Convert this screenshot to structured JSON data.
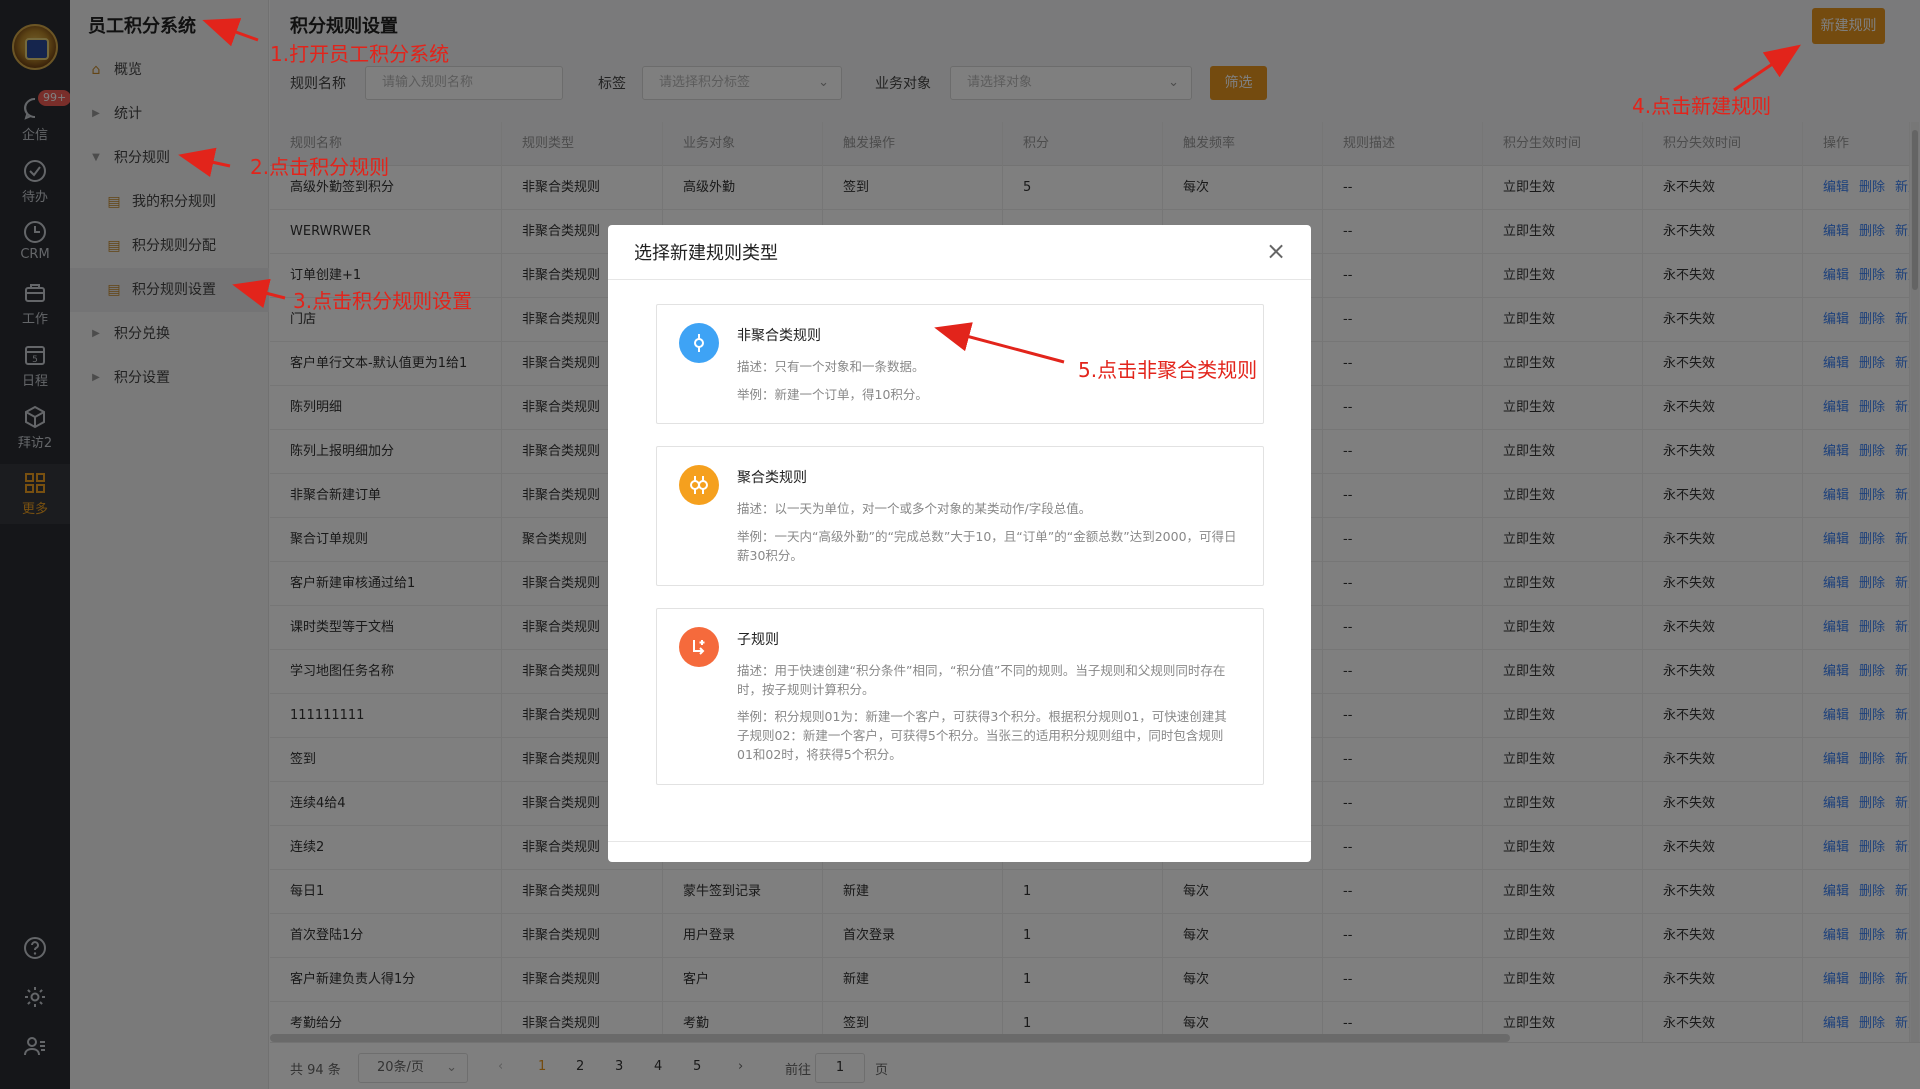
{
  "rail": {
    "items": [
      {
        "label": "企信",
        "icon": "chat-icon",
        "badge": "99+"
      },
      {
        "label": "待办",
        "icon": "check-circle-icon"
      },
      {
        "label": "CRM",
        "icon": "clock-icon"
      },
      {
        "label": "工作",
        "icon": "briefcase-icon"
      },
      {
        "label": "日程",
        "icon": "calendar-icon",
        "day": "5"
      },
      {
        "label": "拜访2",
        "icon": "cube-icon"
      },
      {
        "label": "更多",
        "icon": "grid-icon"
      }
    ],
    "bottom_icons": [
      "help-icon",
      "settings-icon",
      "user-list-icon"
    ]
  },
  "sidebar": {
    "title": "员工积分系统",
    "items": [
      {
        "label": "概览",
        "icon": "home-icon"
      },
      {
        "label": "统计",
        "icon": "caret-right-icon"
      },
      {
        "label": "积分规则",
        "icon": "caret-down-icon"
      },
      {
        "label": "我的积分规则",
        "icon": "doc-icon"
      },
      {
        "label": "积分规则分配",
        "icon": "doc-icon"
      },
      {
        "label": "积分规则设置",
        "icon": "doc-icon"
      },
      {
        "label": "积分兑换",
        "icon": "caret-right-icon"
      },
      {
        "label": "积分设置",
        "icon": "caret-right-icon"
      }
    ]
  },
  "page": {
    "title": "积分规则设置",
    "new_button": "新建规则",
    "filters": {
      "name_label": "规则名称",
      "name_placeholder": "请输入规则名称",
      "tag_label": "标签",
      "tag_placeholder": "请选择积分标签",
      "object_label": "业务对象",
      "object_placeholder": "请选择对象",
      "filter_button": "筛选"
    }
  },
  "table": {
    "columns": [
      "规则名称",
      "规则类型",
      "业务对象",
      "触发操作",
      "积分",
      "触发频率",
      "规则描述",
      "积分生效时间",
      "积分失效时间",
      "操作"
    ],
    "ops": [
      "编辑",
      "删除",
      "新建子规则"
    ],
    "rows": [
      [
        "高级外勤签到积分",
        "非聚合类规则",
        "高级外勤",
        "签到",
        "5",
        "每次",
        "--",
        "立即生效",
        "永不失效"
      ],
      [
        "WERWRWER",
        "非聚合类规则",
        "",
        "",
        "",
        "",
        "--",
        "立即生效",
        "永不失效"
      ],
      [
        "订单创建+1",
        "非聚合类规则",
        "",
        "",
        "",
        "",
        "--",
        "立即生效",
        "永不失效"
      ],
      [
        "门店",
        "非聚合类规则",
        "",
        "",
        "",
        "",
        "--",
        "立即生效",
        "永不失效"
      ],
      [
        "客户单行文本-默认值更为1给1",
        "非聚合类规则",
        "",
        "",
        "",
        "",
        "--",
        "立即生效",
        "永不失效"
      ],
      [
        "陈列明细",
        "非聚合类规则",
        "",
        "",
        "",
        "",
        "--",
        "立即生效",
        "永不失效"
      ],
      [
        "陈列上报明细加分",
        "非聚合类规则",
        "",
        "",
        "",
        "",
        "--",
        "立即生效",
        "永不失效"
      ],
      [
        "非聚合新建订单",
        "非聚合类规则",
        "",
        "",
        "",
        "",
        "--",
        "立即生效",
        "永不失效"
      ],
      [
        "聚合订单规则",
        "聚合类规则",
        "",
        "",
        "",
        "",
        "--",
        "立即生效",
        "永不失效"
      ],
      [
        "客户新建审核通过给1",
        "非聚合类规则",
        "",
        "",
        "",
        "",
        "--",
        "立即生效",
        "永不失效"
      ],
      [
        "课时类型等于文档",
        "非聚合类规则",
        "",
        "",
        "",
        "",
        "--",
        "立即生效",
        "永不失效"
      ],
      [
        "学习地图任务名称",
        "非聚合类规则",
        "",
        "",
        "",
        "",
        "--",
        "立即生效",
        "永不失效"
      ],
      [
        "111111111",
        "非聚合类规则",
        "",
        "",
        "",
        "",
        "--",
        "立即生效",
        "永不失效"
      ],
      [
        "签到",
        "非聚合类规则",
        "",
        "",
        "",
        "",
        "--",
        "立即生效",
        "永不失效"
      ],
      [
        "连续4给4",
        "非聚合类规则",
        "",
        "",
        "",
        "",
        "--",
        "立即生效",
        "永不失效"
      ],
      [
        "连续2",
        "非聚合类规则",
        "",
        "",
        "",
        "",
        "--",
        "立即生效",
        "永不失效"
      ],
      [
        "每日1",
        "非聚合类规则",
        "蒙牛签到记录",
        "新建",
        "1",
        "每次",
        "--",
        "立即生效",
        "永不失效"
      ],
      [
        "首次登陆1分",
        "非聚合类规则",
        "用户登录",
        "首次登录",
        "1",
        "每次",
        "--",
        "立即生效",
        "永不失效"
      ],
      [
        "客户新建负责人得1分",
        "非聚合类规则",
        "客户",
        "新建",
        "1",
        "每次",
        "--",
        "立即生效",
        "永不失效"
      ],
      [
        "考勤给分",
        "非聚合类规则",
        "考勤",
        "签到",
        "1",
        "每次",
        "--",
        "立即生效",
        "永不失效"
      ]
    ]
  },
  "pager": {
    "total": "共 94 条",
    "page_size": "20条/页",
    "pages": [
      "1",
      "2",
      "3",
      "4",
      "5"
    ],
    "prev": "‹",
    "next": "›",
    "goto_label": "前往",
    "goto_value": "1",
    "goto_suffix": "页"
  },
  "modal": {
    "title": "选择新建规则类型",
    "close": "×",
    "cards": [
      {
        "title": "非聚合类规则",
        "icon": "target-icon",
        "color": "#3ea3f5",
        "desc": "描述：只有一个对象和一条数据。",
        "example": "举例：新建一个订单，得10积分。"
      },
      {
        "title": "聚合类规则",
        "icon": "merge-icon",
        "color": "#f5a01e",
        "desc": "描述：以一天为单位，对一个或多个对象的某类动作/字段总值。",
        "example": "举例：一天内“高级外勤”的“完成总数”大于10，且“订单”的“金额总数”达到2000，可得日薪30积分。"
      },
      {
        "title": "子规则",
        "icon": "branch-icon",
        "color": "#f56a3c",
        "desc": "描述：用于快速创建“积分条件”相同，“积分值”不同的规则。当子规则和父规则同时存在时，按子规则计算积分。",
        "example": "举例：积分规则01为：新建一个客户，可获得3个积分。根据积分规则01，可快速创建其子规则02：新建一个客户，可获得5个积分。当张三的适用积分规则组中，同时包含规则01和02时，将获得5个积分。"
      }
    ]
  },
  "annotations": {
    "step1": "1.打开员工积分系统",
    "step2": "2.点击积分规则",
    "step3": "3.点击积分规则设置",
    "step4": "4.点击新建规则",
    "step5": "5.点击非聚合类规则",
    "color": "#e2241b"
  },
  "colors": {
    "accent": "#e8961e",
    "link": "#3b82f6",
    "rail": "#2a2d33"
  }
}
